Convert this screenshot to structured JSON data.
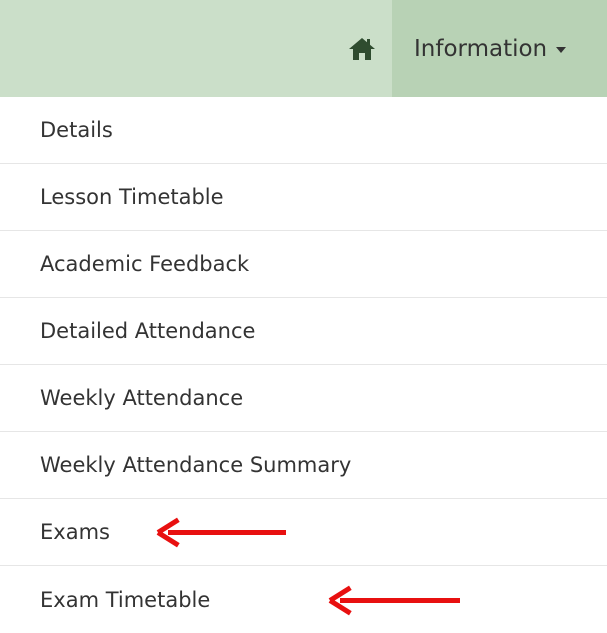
{
  "navbar": {
    "home_icon": "home-icon",
    "information_label": "Information",
    "background": "#cbdfc9",
    "active_background": "#b8d2b5"
  },
  "menu": {
    "items": [
      {
        "label": "Details"
      },
      {
        "label": "Lesson Timetable"
      },
      {
        "label": "Academic Feedback"
      },
      {
        "label": "Detailed Attendance"
      },
      {
        "label": "Weekly Attendance"
      },
      {
        "label": "Weekly Attendance Summary"
      },
      {
        "label": "Exams",
        "annotation": "red-arrow"
      },
      {
        "label": "Exam Timetable",
        "annotation": "red-arrow"
      }
    ]
  },
  "annotation_color": "#e81010"
}
